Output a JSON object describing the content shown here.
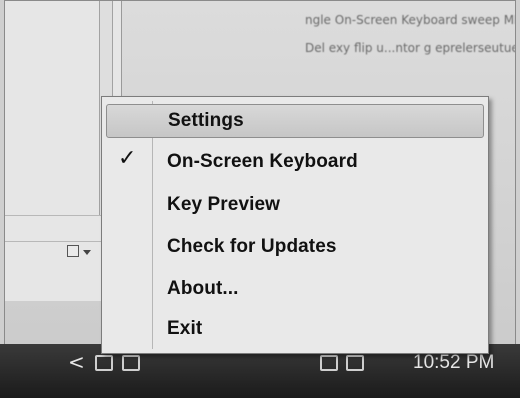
{
  "background": {
    "doc_lines": [
      "ngle On-Screen Keyboard sweep MENU tr... Cub",
      "Del exy  flip  u...ntor  g eprelerseutue ...nup"
    ]
  },
  "context_menu": {
    "items": [
      {
        "label": "Settings",
        "checked": false,
        "highlighted": true
      },
      {
        "label": "On-Screen Keyboard",
        "checked": true,
        "highlighted": false
      },
      {
        "label": "Key Preview",
        "checked": false,
        "highlighted": false
      },
      {
        "label": "Check for Updates",
        "checked": false,
        "highlighted": false
      },
      {
        "label": "About...",
        "checked": false,
        "highlighted": false
      },
      {
        "label": "Exit",
        "checked": false,
        "highlighted": false
      }
    ],
    "check_glyph": "✓"
  },
  "taskbar": {
    "chevron": "<",
    "clock": "10:52 PM",
    "tray_icons": [
      "notification-icon",
      "keyboard-icon",
      "network-icon",
      "volume-icon"
    ]
  },
  "colors": {
    "menu_background": "#e9e9e9",
    "highlight": "#c6c6c6",
    "taskbar": "#1b1b1b"
  }
}
